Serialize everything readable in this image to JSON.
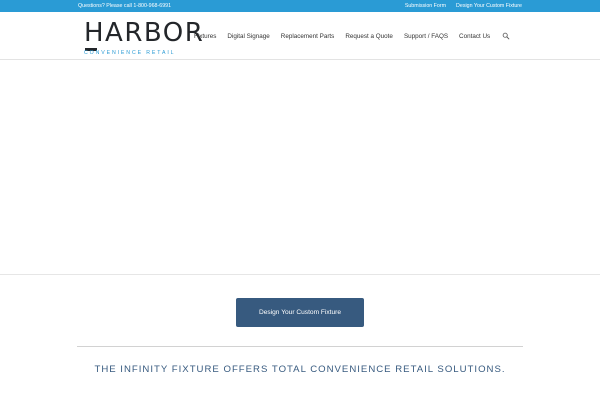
{
  "topbar": {
    "phone_text": "Questions? Please call 1-800-968-6991",
    "links": [
      "Submission Form",
      "Design Your Custom Fixture"
    ]
  },
  "logo": {
    "name": "HARBOR",
    "tagline": "CONVENIENCE RETAIL"
  },
  "nav": {
    "items": [
      "Fixtures",
      "Digital Signage",
      "Replacement Parts",
      "Request a Quote",
      "Support / FAQS",
      "Contact Us"
    ],
    "search_icon": "search-icon"
  },
  "cta": {
    "label": "Design Your Custom Fixture"
  },
  "headline": "THE INFINITY FIXTURE OFFERS TOTAL CONVENIENCE RETAIL SOLUTIONS.",
  "colors": {
    "topbar": "#2a9bd5",
    "button": "#375a7f",
    "headline": "#375a7f",
    "logo_accent": "#2a9bd5"
  }
}
